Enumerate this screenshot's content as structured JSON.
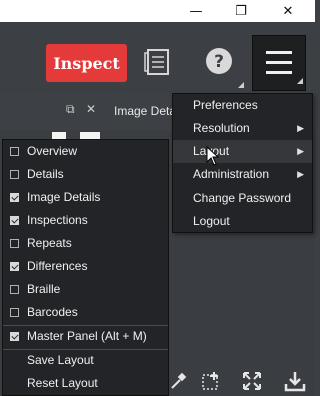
{
  "window": {
    "minimize_glyph": "—",
    "restore_glyph": "❐",
    "close_glyph": "✕"
  },
  "toolbar": {
    "inspect_label": "Inspect",
    "icons": [
      "document-icon",
      "help-icon",
      "hamburger-menu-icon"
    ]
  },
  "panel": {
    "title": "Image Deta",
    "float_glyph": "⧉",
    "close_glyph": "✕"
  },
  "main_menu": {
    "items": [
      {
        "label": "Preferences",
        "submenu": false
      },
      {
        "label": "Resolution",
        "submenu": true
      },
      {
        "label": "Layout",
        "submenu": true
      },
      {
        "label": "Administration",
        "submenu": true
      },
      {
        "label": "Change Password",
        "submenu": false
      },
      {
        "label": "Logout",
        "submenu": false
      }
    ],
    "arrow": "▶"
  },
  "layout_menu": {
    "items": [
      {
        "label": "Overview",
        "checked": false
      },
      {
        "label": "Details",
        "checked": false
      },
      {
        "label": "Image Details",
        "checked": true
      },
      {
        "label": "Inspections",
        "checked": true
      },
      {
        "label": "Repeats",
        "checked": false
      },
      {
        "label": "Differences",
        "checked": true
      },
      {
        "label": "Braille",
        "checked": false
      },
      {
        "label": "Barcodes",
        "checked": false
      },
      {
        "label": "Master Panel (Alt + M)",
        "checked": true
      }
    ],
    "actions": [
      "Save Layout",
      "Reset Layout"
    ]
  },
  "colors": {
    "accent": "#e53a3a",
    "menu_bg": "#232427",
    "toolbar_bg": "#3c3f44"
  }
}
